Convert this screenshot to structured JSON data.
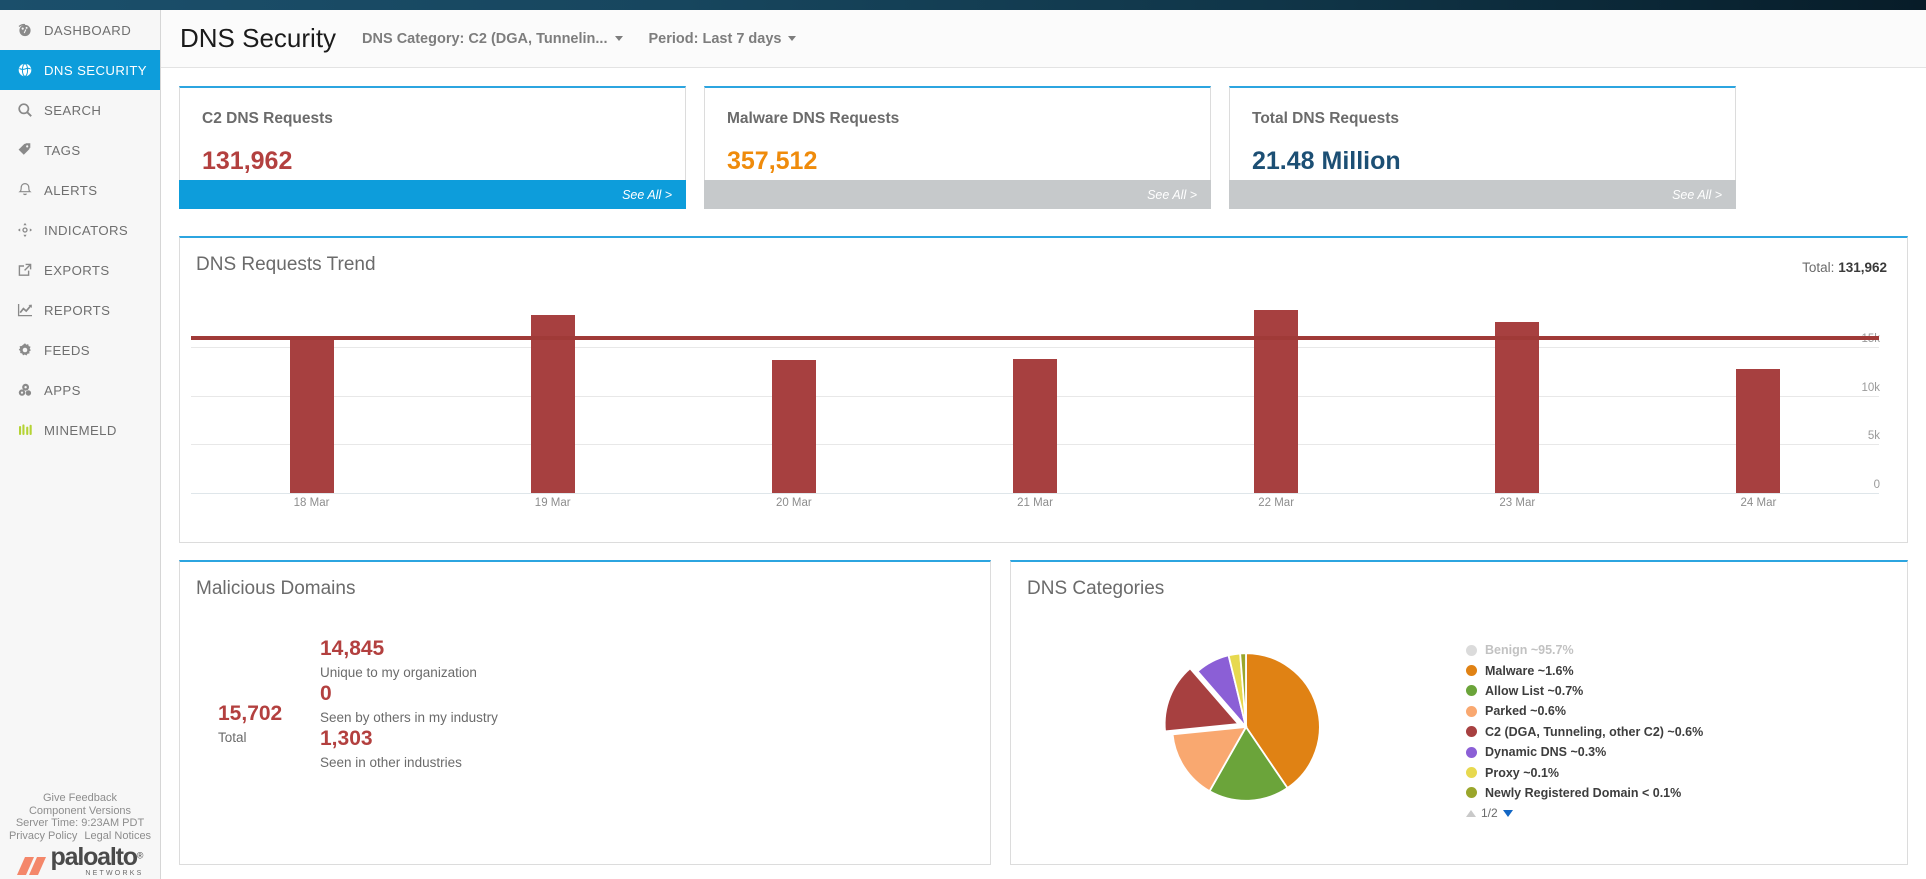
{
  "sidebar": {
    "items": [
      {
        "label": "DASHBOARD",
        "icon": "gauge-icon",
        "active": false
      },
      {
        "label": "DNS SECURITY",
        "icon": "globe-icon",
        "active": true
      },
      {
        "label": "SEARCH",
        "icon": "search-icon",
        "active": false
      },
      {
        "label": "TAGS",
        "icon": "tag-icon",
        "active": false
      },
      {
        "label": "ALERTS",
        "icon": "bell-icon",
        "active": false
      },
      {
        "label": "INDICATORS",
        "icon": "crosshair-icon",
        "active": false
      },
      {
        "label": "EXPORTS",
        "icon": "external-link-icon",
        "active": false
      },
      {
        "label": "REPORTS",
        "icon": "chart-line-icon",
        "active": false
      },
      {
        "label": "FEEDS",
        "icon": "gear-icon",
        "active": false
      },
      {
        "label": "APPS",
        "icon": "cubes-icon",
        "active": false
      },
      {
        "label": "MINEMELD",
        "icon": "minemeld-icon",
        "active": false
      }
    ],
    "footer": {
      "give_feedback": "Give Feedback",
      "component_versions": "Component Versions",
      "server_time": "Server Time: 9:23AM PDT",
      "privacy_policy": "Privacy Policy",
      "legal_notices": "Legal Notices",
      "brand_word": "paloalto",
      "brand_reg": "®",
      "brand_sub": "NETWORKS"
    }
  },
  "header": {
    "title": "DNS Security",
    "filters": [
      {
        "label": "DNS Category: C2 (DGA, Tunnelin...",
        "name": "dns-category-filter"
      },
      {
        "label": "Period: Last 7 days",
        "name": "period-filter"
      }
    ]
  },
  "kpi_cards": [
    {
      "title": "C2 DNS Requests",
      "value": "131,962",
      "value_color": "#b3403f",
      "footer_label": "See All >",
      "footer_style": "blue"
    },
    {
      "title": "Malware DNS Requests",
      "value": "357,512",
      "value_color": "#ef8b0b",
      "footer_label": "See All >",
      "footer_style": "grey"
    },
    {
      "title": "Total DNS Requests",
      "value": "21.48 Million",
      "value_color": "#1c4f74",
      "footer_label": "See All >",
      "footer_style": "grey"
    }
  ],
  "trend": {
    "title": "DNS Requests Trend",
    "total_label": "Total:",
    "total_value": "131,962"
  },
  "malicious_domains": {
    "title": "Malicious Domains",
    "total_value": "15,702",
    "total_label": "Total",
    "rows": [
      {
        "value": "14,845",
        "label": "Unique to my organization"
      },
      {
        "value": "0",
        "label": "Seen by others in my industry"
      },
      {
        "value": "1,303",
        "label": "Seen in other industries"
      }
    ]
  },
  "dns_categories": {
    "title": "DNS Categories",
    "pager_label": "1/2"
  },
  "chart_data": [
    {
      "type": "bar",
      "title": "DNS Requests Trend",
      "categories": [
        "18 Mar",
        "19 Mar",
        "20 Mar",
        "21 Mar",
        "22 Mar",
        "23 Mar",
        "24 Mar"
      ],
      "values": [
        16100,
        18300,
        13600,
        13700,
        18800,
        17500,
        12700
      ],
      "bar_color": "#a74040",
      "average_line": {
        "value": 15900,
        "color": "#a03a38"
      },
      "xlabel": "",
      "ylabel": "",
      "ylim": [
        0,
        20000
      ],
      "yticks": [
        0,
        5000,
        10000,
        15000
      ],
      "ytick_labels": [
        "0",
        "5k",
        "10k",
        "15k"
      ],
      "grid": true,
      "legend": false
    },
    {
      "type": "pie",
      "title": "DNS Categories",
      "legend_position": "right",
      "labels": [
        "Benign ~95.7%",
        "Malware ~1.6%",
        "Allow List ~0.7%",
        "Parked ~0.6%",
        "C2 (DGA, Tunneling, other C2) ~0.6%",
        "Dynamic DNS ~0.3%",
        "Proxy ~0.1%",
        "Newly Registered Domain < 0.1%"
      ],
      "categories": [
        "Benign",
        "Malware",
        "Allow List",
        "Parked",
        "C2 (DGA, Tunneling, other C2)",
        "Dynamic DNS",
        "Proxy",
        "Newly Registered Domain"
      ],
      "values": [
        95.7,
        1.6,
        0.7,
        0.6,
        0.6,
        0.3,
        0.1,
        0.05
      ],
      "colors": [
        "#bdbdbd",
        "#e08214",
        "#6ba43a",
        "#f7a濃",
        "#a74040",
        "#8b5fd6",
        "#e7d94f",
        "#9aa62b"
      ],
      "slice_colors": [
        "#bdbdbd",
        "#e08214",
        "#6ba43a",
        "#f9a濃",
        "#a74040",
        "#8b5fd6",
        "#e7d94f",
        "#9aa62b"
      ],
      "plotted_values": [
        1.6,
        0.7,
        0.6,
        0.6,
        0.3,
        0.1,
        0.05
      ],
      "exploded": [
        "C2 (DGA, Tunneling, other C2)"
      ],
      "muted": [
        "Benign"
      ]
    }
  ]
}
